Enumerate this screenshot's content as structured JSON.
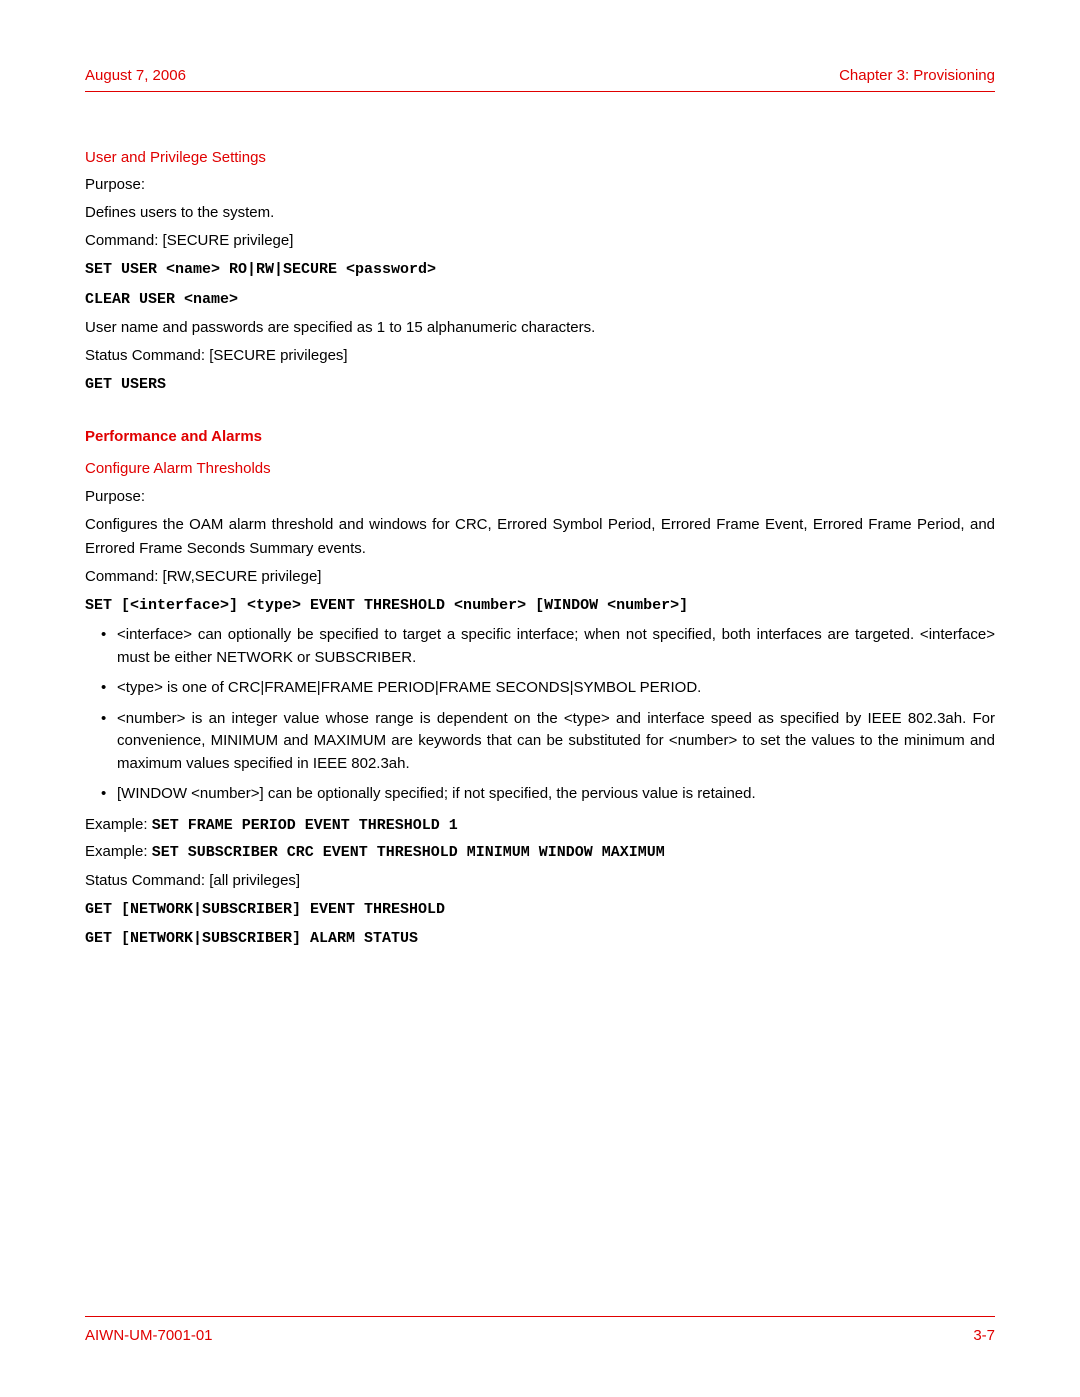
{
  "header": {
    "date": "August 7, 2006",
    "chapter": "Chapter 3: Provisioning"
  },
  "footer": {
    "docid": "AIWN-UM-7001-01",
    "pagenum": "3-7"
  },
  "section1": {
    "title": "User and Privilege Settings",
    "purpose_label": "Purpose:",
    "purpose_text": "Defines users to the system.",
    "command_label": "Command: [SECURE privilege]",
    "cmd1": "SET USER <name> RO|RW|SECURE <password>",
    "cmd2": "CLEAR USER <name>",
    "note1": "User name and passwords are specified as 1 to 15 alphanumeric characters.",
    "status_label": "Status Command: [SECURE privileges]",
    "cmd3": "GET USERS"
  },
  "section2": {
    "main_title": "Performance and Alarms",
    "sub_title": "Configure Alarm Thresholds",
    "purpose_label": "Purpose:",
    "purpose_text": "Configures the OAM alarm threshold and windows for CRC, Errored Symbol Period, Errored Frame Event, Errored Frame Period, and Errored Frame Seconds Summary events.",
    "command_label": "Command: [RW,SECURE privilege]",
    "cmd1": "SET [<interface>] <type> EVENT THRESHOLD <number> [WINDOW <number>]",
    "bullets": [
      "<interface> can optionally be specified to target a specific interface; when not specified, both interfaces are targeted. <interface> must be either NETWORK or SUBSCRIBER.",
      "<type> is one of CRC|FRAME|FRAME PERIOD|FRAME SECONDS|SYMBOL PERIOD.",
      "<number> is an integer value whose range is dependent on the <type> and interface speed as specified by IEEE 802.3ah. For convenience, MINIMUM and MAXIMUM are keywords that can be substituted for <number> to set the values to the minimum and maximum values specified in IEEE 802.3ah.",
      "[WINDOW <number>] can be optionally specified; if not specified, the pervious value is retained."
    ],
    "example_label": "Example: ",
    "example1_cmd": "SET FRAME PERIOD EVENT THRESHOLD 1",
    "example2_cmd": "SET SUBSCRIBER CRC EVENT THRESHOLD MINIMUM WINDOW MAXIMUM",
    "status_label": "Status Command: [all privileges]",
    "cmd2": "GET [NETWORK|SUBSCRIBER] EVENT THRESHOLD",
    "cmd3": "GET [NETWORK|SUBSCRIBER] ALARM STATUS"
  }
}
